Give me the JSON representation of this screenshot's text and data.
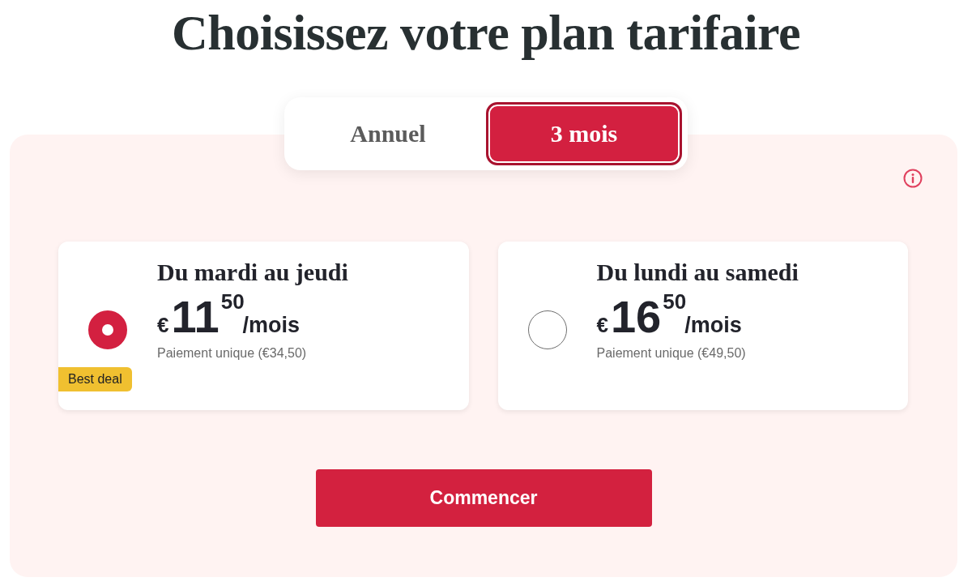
{
  "heading": "Choisissez votre plan tarifaire",
  "billing_tabs": [
    {
      "label": "Annuel",
      "selected": false
    },
    {
      "label": "3 mois",
      "selected": true
    }
  ],
  "plans": [
    {
      "title": "Du mardi au jeudi",
      "selected": true,
      "currency": "€",
      "price_whole": "11",
      "price_cents": "50",
      "period": "/mois",
      "note": "Paiement unique (€34,50)",
      "badge": "Best deal"
    },
    {
      "title": "Du lundi au samedi",
      "selected": false,
      "currency": "€",
      "price_whole": "16",
      "price_cents": "50",
      "period": "/mois",
      "note": "Paiement unique (€49,50)"
    }
  ],
  "cta": "Commencer"
}
